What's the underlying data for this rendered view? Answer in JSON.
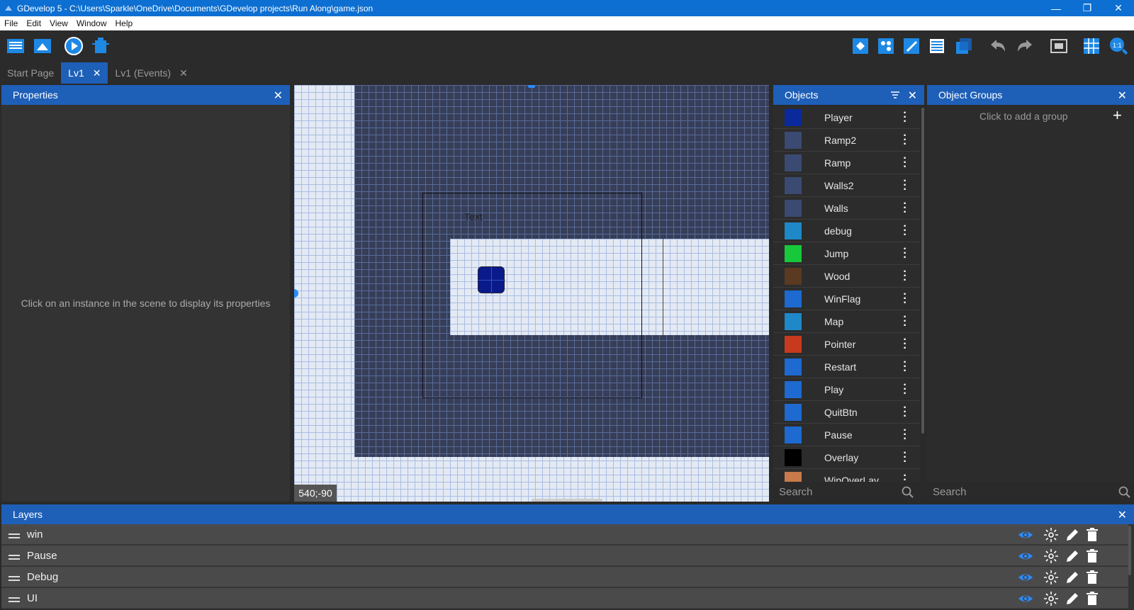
{
  "window": {
    "title": "GDevelop 5 - C:\\Users\\Sparkle\\OneDrive\\Documents\\GDevelop projects\\Run Along\\game.json"
  },
  "menu": [
    "File",
    "Edit",
    "View",
    "Window",
    "Help"
  ],
  "tabs": [
    {
      "label": "Start Page",
      "closable": false
    },
    {
      "label": "Lv1",
      "closable": true
    },
    {
      "label": "Lv1 (Events)",
      "closable": true
    }
  ],
  "properties": {
    "title": "Properties",
    "empty_message": "Click on an instance in the scene to display its properties"
  },
  "canvas": {
    "coords": "540;-90",
    "text_label": "Text"
  },
  "objects": {
    "title": "Objects",
    "search_placeholder": "Search",
    "items": [
      {
        "name": "Player",
        "thumb": "#0a2a9c"
      },
      {
        "name": "Ramp2",
        "thumb": "#3a4a72"
      },
      {
        "name": "Ramp",
        "thumb": "#3a4a72"
      },
      {
        "name": "Walls2",
        "thumb": "#3a4a72"
      },
      {
        "name": "Walls",
        "thumb": "#3a4a72"
      },
      {
        "name": "debug",
        "thumb": "#1e88c8"
      },
      {
        "name": "Jump",
        "thumb": "#16c83a"
      },
      {
        "name": "Wood",
        "thumb": "#5a3a20"
      },
      {
        "name": "WinFlag",
        "thumb": "#1e6ad0"
      },
      {
        "name": "Map",
        "thumb": "#1e88c8"
      },
      {
        "name": "Pointer",
        "thumb": "#c83a1e"
      },
      {
        "name": "Restart",
        "thumb": "#1e6ad0"
      },
      {
        "name": "Play",
        "thumb": "#1e6ad0"
      },
      {
        "name": "QuitBtn",
        "thumb": "#1e6ad0"
      },
      {
        "name": "Pause",
        "thumb": "#1e6ad0"
      },
      {
        "name": "Overlay",
        "thumb": "#000000"
      },
      {
        "name": "WinOverLay",
        "thumb": "#c87a4a"
      }
    ]
  },
  "groups": {
    "title": "Object Groups",
    "add_label": "Click to add a group",
    "search_placeholder": "Search"
  },
  "layers": {
    "title": "Layers",
    "items": [
      {
        "name": "win"
      },
      {
        "name": "Pause"
      },
      {
        "name": "Debug"
      },
      {
        "name": "UI"
      }
    ]
  },
  "colors": {
    "accent": "#1e5fb8",
    "titlebar": "#0c6fd1",
    "visible_eye": "#2a8cff"
  }
}
